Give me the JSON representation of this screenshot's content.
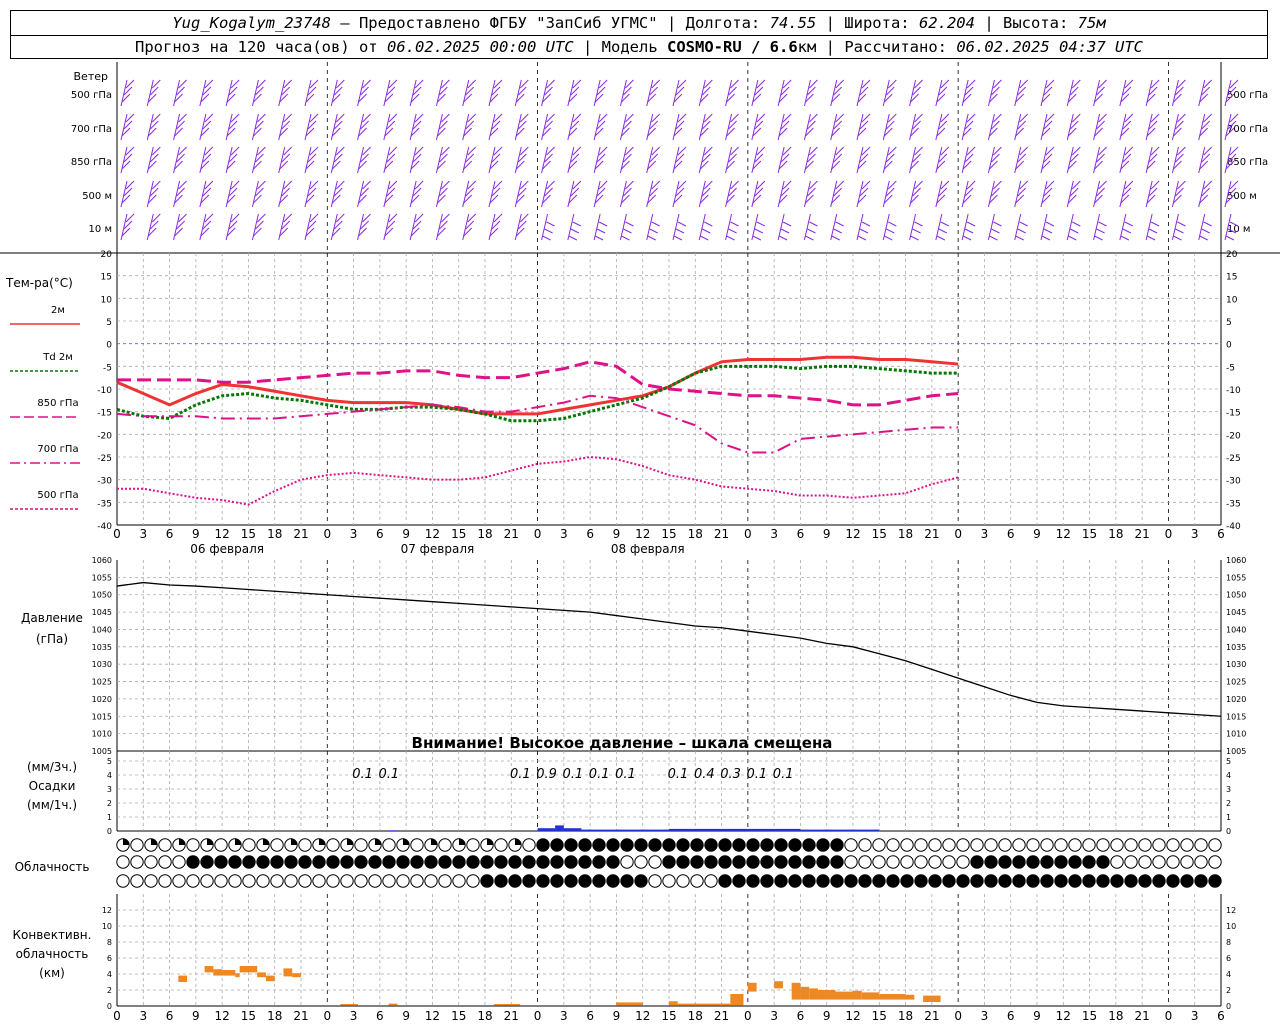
{
  "header": {
    "station": "Yug_Kogalym_23748",
    "provider_sep": " — ",
    "provider": "Предоставлено ФГБУ \"ЗапСиб УГМС\"",
    "lon_label": "Долгота:",
    "lon_value": "74.55",
    "lat_label": "Широта:",
    "lat_value": "62.204",
    "alt_label": "Высота:",
    "alt_value": "75м",
    "forecast_label": "Прогноз на 120 часа(ов) от",
    "forecast_start": "06.02.2025 00:00 UTC",
    "model_label": "Модель",
    "model_name": "COSMO-RU / 6.6",
    "model_unit": "км",
    "calc_label": "Рассчитано:",
    "calc_time": "06.02.2025 04:37 UTC"
  },
  "colors": {
    "wind": "#8a2be2",
    "t2m": "#ee3333",
    "td2m": "#007700",
    "t850": "#dd1188",
    "t700": "#dd1188",
    "t500": "#dd1188",
    "pressure": "#000000",
    "precip": "#2233cc",
    "convective": "#ee8822",
    "grid": "#aaaaaa"
  },
  "chart_data": [
    {
      "type": "wind_barbs",
      "title": "Ветер",
      "levels": [
        "500 гПа",
        "700 гПа",
        "850 гПа",
        "500 м",
        "10  м"
      ],
      "note": "wind barbs, 3-hourly, shown from analysis to +126h"
    },
    {
      "type": "line",
      "title": "Тем-ра(°C)",
      "ylim": [
        -40,
        20
      ],
      "yticks": [
        20,
        15,
        10,
        5,
        0,
        -5,
        -10,
        -15,
        -20,
        -25,
        -30,
        -35,
        -40
      ],
      "x_hours": [
        0,
        3,
        6,
        9,
        12,
        15,
        18,
        21,
        24,
        27,
        30,
        33,
        36,
        39,
        42,
        45,
        48,
        51,
        54,
        57,
        60,
        63,
        66,
        69,
        72,
        75,
        78,
        81,
        84,
        87,
        90,
        93,
        96,
        99,
        102,
        105,
        108,
        111,
        114,
        117,
        120,
        123,
        126
      ],
      "series": [
        {
          "name": "2м",
          "style": "solid",
          "values": [
            -8.5,
            -11,
            -13.5,
            -11,
            -9,
            -9.5,
            -10.5,
            -11.5,
            -12.5,
            -13,
            -13,
            -13,
            -13.5,
            -14.5,
            -15.5,
            -15.5,
            -15.5,
            -14.5,
            -13.5,
            -12.5,
            -11.5,
            -9.5,
            -6.5,
            -4,
            -3.5,
            -3.5,
            -3.5,
            -3,
            -3,
            -3.5,
            -3.5,
            -4,
            -4.5
          ]
        },
        {
          "name": "Td  2м",
          "style": "dotted",
          "values": [
            -14.5,
            -16,
            -16.5,
            -13.5,
            -11.5,
            -11,
            -12,
            -12.5,
            -13.5,
            -14.5,
            -14.5,
            -14,
            -14,
            -14.5,
            -15.5,
            -17,
            -17,
            -16.5,
            -15,
            -13.5,
            -12,
            -9.5,
            -6.5,
            -5,
            -5,
            -5,
            -5.5,
            -5,
            -5,
            -5.5,
            -6,
            -6.5,
            -6.5
          ]
        },
        {
          "name": "850 гПа",
          "style": "long-dash",
          "values": [
            -8,
            -8,
            -8,
            -8,
            -8.5,
            -8.5,
            -8,
            -7.5,
            -7,
            -6.5,
            -6.5,
            -6,
            -6,
            -7,
            -7.5,
            -7.5,
            -6.5,
            -5.5,
            -4,
            -5,
            -9,
            -10,
            -10.5,
            -11,
            -11.5,
            -11.5,
            -12,
            -12.5,
            -13.5,
            -13.5,
            -12.5,
            -11.5,
            -11
          ]
        },
        {
          "name": "700 гПа",
          "style": "dash-dot",
          "values": [
            -15.5,
            -16,
            -16,
            -16,
            -16.5,
            -16.5,
            -16.5,
            -16,
            -15.5,
            -15,
            -14.5,
            -14,
            -13.5,
            -14,
            -15,
            -15,
            -14,
            -13,
            -11.5,
            -12,
            -14,
            -16,
            -18,
            -22,
            -24,
            -24,
            -21,
            -20.5,
            -20,
            -19.5,
            -19,
            -18.5,
            -18.5
          ]
        },
        {
          "name": "500 гПа",
          "style": "dotted",
          "values": [
            -32,
            -32,
            -33,
            -34,
            -34.5,
            -35.5,
            -32.5,
            -30,
            -29,
            -28.5,
            -29,
            -29.5,
            -30,
            -30,
            -29.5,
            -28,
            -26.5,
            -26,
            -25,
            -25.5,
            -27,
            -29,
            -30,
            -31.5,
            -32,
            -32.5,
            -33.5,
            -33.5,
            -34,
            -33.5,
            -33,
            -31,
            -29.5
          ]
        }
      ],
      "xticks_row": [
        "0",
        "3",
        "6",
        "9",
        "12",
        "15",
        "18",
        "21",
        "0",
        "3",
        "6",
        "9",
        "12",
        "15",
        "18",
        "21",
        "0",
        "3",
        "6",
        "9",
        "12",
        "15",
        "18",
        "21",
        "0",
        "3",
        "6"
      ],
      "dates": [
        "06 февраля",
        "07 февраля",
        "08 февраля"
      ]
    },
    {
      "type": "line",
      "title": "Давление",
      "ylabel": "(гПа)",
      "ylim": [
        1005,
        1060
      ],
      "yticks": [
        1060,
        1055,
        1050,
        1045,
        1040,
        1035,
        1030,
        1025,
        1020,
        1015,
        1010,
        1005
      ],
      "x_hours": [
        0,
        3,
        6,
        9,
        12,
        15,
        18,
        21,
        24,
        27,
        30,
        33,
        36,
        39,
        42,
        45,
        48,
        51,
        54,
        57,
        60,
        63,
        66,
        69,
        72,
        75,
        78,
        81,
        84,
        87,
        90,
        93,
        96,
        99,
        102,
        105,
        108,
        111,
        114,
        117,
        120,
        123,
        126
      ],
      "series": [
        {
          "name": "pressure",
          "values": [
            1052.5,
            1053.5,
            1052.8,
            1052.5,
            1052,
            1051.5,
            1051,
            1050.5,
            1050,
            1049.5,
            1049,
            1048.5,
            1048,
            1047.5,
            1047,
            1046.5,
            1046,
            1045.5,
            1045,
            1044,
            1043,
            1042,
            1041,
            1040.5,
            1039.5,
            1038.5,
            1037.5,
            1036,
            1035,
            1033,
            1031,
            1028.5,
            1026,
            1023.5,
            1021,
            1019,
            1018,
            1017.5,
            1017,
            1016.5,
            1016,
            1015.5,
            1015
          ]
        },
        {
          "name": "pressure-late",
          "values": []
        }
      ],
      "note_text": "Внимание! Высокое давление – шкала смещена"
    },
    {
      "type": "bar",
      "title": "Осадки",
      "ylabel_3h": "(мм/3ч.)",
      "ylabel_1h": "(мм/1ч.)",
      "ylim": [
        0,
        5
      ],
      "yticks": [
        5,
        4,
        3,
        2,
        1,
        0
      ],
      "amounts_3h": [
        {
          "hour": 27,
          "label": "0.1"
        },
        {
          "hour": 30,
          "label": "0.1"
        },
        {
          "hour": 45,
          "label": "0.1"
        },
        {
          "hour": 48,
          "label": "0.9"
        },
        {
          "hour": 51,
          "label": "0.1"
        },
        {
          "hour": 54,
          "label": "0.1"
        },
        {
          "hour": 57,
          "label": "0.1"
        },
        {
          "hour": 63,
          "label": "0.1"
        },
        {
          "hour": 66,
          "label": "0.4"
        },
        {
          "hour": 69,
          "label": "0.3"
        },
        {
          "hour": 72,
          "label": "0.1"
        },
        {
          "hour": 75,
          "label": "0.1"
        }
      ],
      "hourly_bars": [
        {
          "from": 31,
          "to": 32,
          "value": 0.05
        },
        {
          "from": 48,
          "to": 50,
          "value": 0.2
        },
        {
          "from": 50,
          "to": 51,
          "value": 0.4
        },
        {
          "from": 51,
          "to": 53,
          "value": 0.2
        },
        {
          "from": 53,
          "to": 63,
          "value": 0.1
        },
        {
          "from": 63,
          "to": 78,
          "value": 0.15
        },
        {
          "from": 78,
          "to": 87,
          "value": 0.1
        }
      ]
    },
    {
      "type": "cloud_symbols",
      "title": "Облачность",
      "rows": [
        "qqqqqqqqqqqqqqqqqqqqqqqqqqqqqqqqqqqqqqqqqqqqqqqqqqqqqqqqqqqqqqqqqqqqqqqqqqqqqqqqqqqqqqqqqqqq",
        "oooooqqffffffffqqffffffffffffffffffffqqfqqffffffffffffffffffffffffffffoooooooooooooooooooffffffffffffffffffffffffqqhhooooooooooo",
        "oooooooooooooooooooooooooooooooooffffffffffffffffoooooffffffffffffffffffffffffffffffffffffffffffffffffffffffffffff"
      ]
    },
    {
      "type": "bar",
      "title": "Конвективн.",
      "title2": "облачность",
      "ylabel": "(км)",
      "ylim": [
        0,
        14
      ],
      "yticks": [
        12,
        10,
        8,
        6,
        4,
        2,
        0
      ],
      "bars": [
        {
          "from": 7,
          "to": 8,
          "bottom": 3,
          "top": 3.8
        },
        {
          "from": 10,
          "to": 11,
          "bottom": 4.2,
          "top": 5
        },
        {
          "from": 11,
          "to": 12,
          "bottom": 3.8,
          "top": 4.6
        },
        {
          "from": 12,
          "to": 13.5,
          "bottom": 3.8,
          "top": 4.5
        },
        {
          "from": 13.5,
          "to": 14,
          "bottom": 3.6,
          "top": 4.1
        },
        {
          "from": 14,
          "to": 16,
          "bottom": 4.2,
          "top": 5
        },
        {
          "from": 16,
          "to": 17,
          "bottom": 3.6,
          "top": 4.2
        },
        {
          "from": 17,
          "to": 18,
          "bottom": 3.1,
          "top": 3.8
        },
        {
          "from": 19,
          "to": 20,
          "bottom": 3.7,
          "top": 4.7
        },
        {
          "from": 20,
          "to": 21,
          "bottom": 3.6,
          "top": 4.1
        },
        {
          "from": 25.5,
          "to": 27.5,
          "bottom": 0.1,
          "top": 0.25
        },
        {
          "from": 31,
          "to": 32,
          "bottom": 0.1,
          "top": 0.3
        },
        {
          "from": 43,
          "to": 46,
          "bottom": 0.1,
          "top": 0.25
        },
        {
          "from": 57,
          "to": 60,
          "bottom": 0.1,
          "top": 0.45
        },
        {
          "from": 63,
          "to": 64,
          "bottom": 0.1,
          "top": 0.6
        },
        {
          "from": 64,
          "to": 70,
          "bottom": 0.1,
          "top": 0.3
        },
        {
          "from": 70,
          "to": 71.5,
          "bottom": 0.1,
          "top": 1.5
        },
        {
          "from": 72,
          "to": 73,
          "bottom": 1.8,
          "top": 2.9
        },
        {
          "from": 75,
          "to": 76,
          "bottom": 2.2,
          "top": 3.1
        },
        {
          "from": 77,
          "to": 78,
          "bottom": 0.8,
          "top": 2.9
        },
        {
          "from": 78,
          "to": 79,
          "bottom": 0.8,
          "top": 2.4
        },
        {
          "from": 79,
          "to": 80,
          "bottom": 0.8,
          "top": 2.2
        },
        {
          "from": 80,
          "to": 82,
          "bottom": 0.8,
          "top": 2
        },
        {
          "from": 82,
          "to": 84,
          "bottom": 0.8,
          "top": 1.8
        },
        {
          "from": 84,
          "to": 85,
          "bottom": 0.8,
          "top": 1.9
        },
        {
          "from": 85,
          "to": 87,
          "bottom": 0.8,
          "top": 1.7
        },
        {
          "from": 87,
          "to": 90,
          "bottom": 0.8,
          "top": 1.5
        },
        {
          "from": 90,
          "to": 91,
          "bottom": 0.8,
          "top": 1.4
        },
        {
          "from": 92,
          "to": 94,
          "bottom": 0.5,
          "top": 1.3
        }
      ]
    }
  ]
}
